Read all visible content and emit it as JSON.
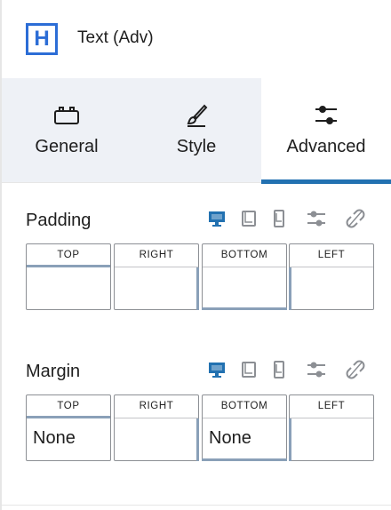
{
  "header": {
    "icon_letter": "H",
    "title": "Text (Adv)"
  },
  "tabs": [
    {
      "label": "General",
      "icon": "toolbox-icon",
      "active": false
    },
    {
      "label": "Style",
      "icon": "brush-icon",
      "active": false
    },
    {
      "label": "Advanced",
      "icon": "sliders-icon",
      "active": true
    }
  ],
  "padding": {
    "title": "Padding",
    "devices": [
      "desktop-icon",
      "tablet-icon",
      "mobile-icon",
      "sliders-icon",
      "unlink-icon"
    ],
    "sides": [
      {
        "label": "TOP",
        "value": ""
      },
      {
        "label": "RIGHT",
        "value": ""
      },
      {
        "label": "BOTTOM",
        "value": ""
      },
      {
        "label": "LEFT",
        "value": ""
      }
    ]
  },
  "margin": {
    "title": "Margin",
    "devices": [
      "desktop-icon",
      "tablet-icon",
      "mobile-icon",
      "sliders-icon",
      "unlink-icon"
    ],
    "sides": [
      {
        "label": "TOP",
        "value": "None"
      },
      {
        "label": "RIGHT",
        "value": ""
      },
      {
        "label": "BOTTOM",
        "value": "None"
      },
      {
        "label": "LEFT",
        "value": ""
      }
    ]
  },
  "colors": {
    "accent": "#2271b1",
    "brand_icon": "#2c6dd6",
    "side_indicator": "#8aa0b8"
  }
}
